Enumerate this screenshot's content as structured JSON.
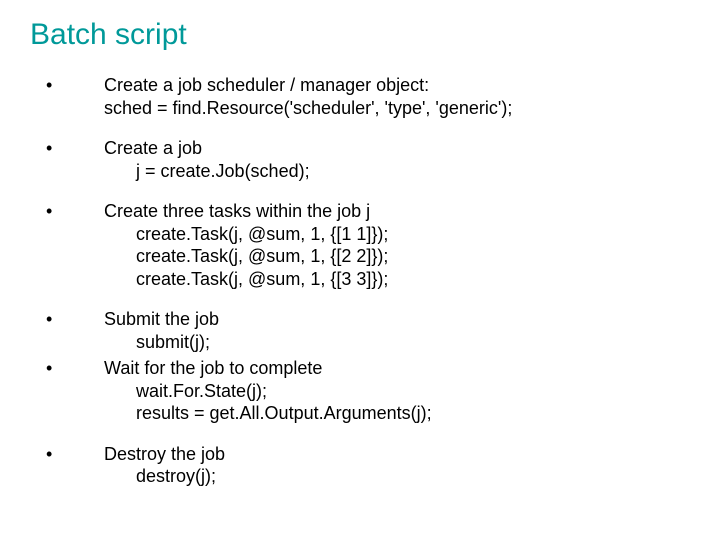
{
  "title": "Batch script",
  "bullets": [
    {
      "lead": "Create a job scheduler / manager object:",
      "lines": [
        "sched = find.Resource('scheduler', 'type', 'generic');"
      ],
      "indent": "small"
    },
    {
      "lead": "Create a job",
      "lines": [
        "j = create.Job(sched);"
      ],
      "indent": "normal"
    },
    {
      "lead": "Create three tasks within the job j",
      "lines": [
        "create.Task(j, @sum, 1, {[1 1]});",
        "create.Task(j, @sum, 1, {[2 2]});",
        "create.Task(j, @sum, 1, {[3 3]});"
      ],
      "indent": "normal"
    },
    {
      "lead": "Submit the job",
      "lines": [
        "submit(j);"
      ],
      "indent": "normal",
      "tight": true
    },
    {
      "lead": "Wait for the job to complete",
      "lines": [
        "wait.For.State(j);",
        "results = get.All.Output.Arguments(j);"
      ],
      "indent": "normal"
    },
    {
      "lead": "Destroy the job",
      "lines": [
        "destroy(j);"
      ],
      "indent": "normal"
    }
  ]
}
